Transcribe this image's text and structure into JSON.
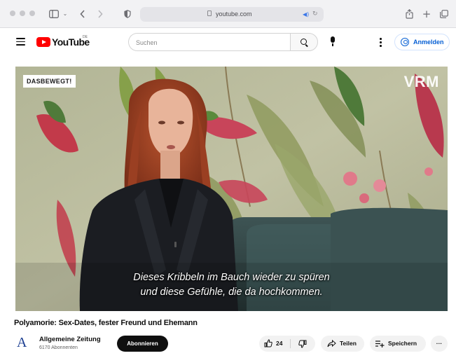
{
  "browser": {
    "url": "youtube.com",
    "nav_icons": [
      "sidebar-icon",
      "back-icon",
      "forward-icon",
      "privacy-shield-icon"
    ],
    "action_icons": [
      "share-icon",
      "new-tab-icon",
      "tabs-overview-icon"
    ]
  },
  "header": {
    "logo_text": "YouTube",
    "logo_country": "DE",
    "search_placeholder": "Suchen",
    "signin_label": "Anmelden"
  },
  "video": {
    "badge": "DASBEWEGT!",
    "brand_mark": "VRM",
    "subtitle_lines": [
      "Dieses Kribbeln im Bauch wieder zu spüren",
      "und diese Gefühle, die da hochkommen."
    ],
    "title": "Polyamorie: Sex-Dates, fester Freund und Ehemann"
  },
  "channel": {
    "logo_glyph": "A",
    "name": "Allgemeine Zeitung",
    "subscribers": "6170 Abonnenten",
    "subscribe_label": "Abonnieren"
  },
  "actions": {
    "like_count": "24",
    "share_label": "Teilen",
    "save_label": "Speichern",
    "more_label": "···"
  },
  "colors": {
    "youtube_red": "#ff0000",
    "signin_blue": "#065fd4",
    "channel_blue": "#1c3f91",
    "subscribe_bg": "#0f0f0f"
  }
}
